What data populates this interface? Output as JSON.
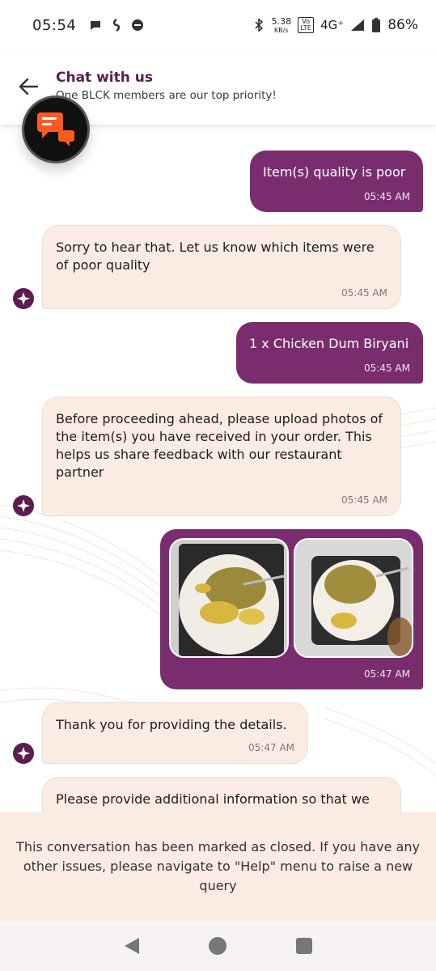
{
  "status_bar": {
    "time": "05:54",
    "net_speed_value": "5.38",
    "net_speed_unit": "KB/s",
    "volte": "Vo LTE",
    "network": "4G⁺",
    "battery": "86%"
  },
  "header": {
    "title": "Chat with us",
    "subtitle": "One BLCK members are our top priority!"
  },
  "messages": [
    {
      "from": "user",
      "text": "Item(s) quality is poor",
      "time": "05:45 AM"
    },
    {
      "from": "bot",
      "text": "Sorry to hear that. Let us know which items were of poor quality",
      "time": "05:45 AM"
    },
    {
      "from": "user",
      "text": "1 x Chicken Dum Biryani",
      "time": "05:45 AM"
    },
    {
      "from": "bot",
      "text": "Before proceeding ahead, please upload photos of the item(s) you have received in your order. This helps us share feedback with our restaurant partner",
      "time": "05:45 AM"
    },
    {
      "from": "user",
      "type": "images",
      "time": "05:47 AM"
    },
    {
      "from": "bot",
      "text": "Thank you for providing the details.",
      "time": "05:47 AM"
    },
    {
      "from": "bot",
      "text": "Please provide additional information so that we"
    }
  ],
  "closed_notice": "This conversation has been marked as closed. If you have any other issues, please navigate to \"Help\" menu to raise a new query",
  "colors": {
    "user_bubble": "#7a2d6e",
    "bot_bubble": "#faece3",
    "brand_dark": "#5b1d4f",
    "avatar_accent": "#ff5a1f"
  },
  "icons": {
    "back": "arrow-left-icon",
    "agent": "chat-bubbles-icon",
    "bot": "sparkle-icon",
    "nav_back": "triangle-back-icon",
    "nav_home": "circle-home-icon",
    "nav_recents": "square-recents-icon"
  }
}
